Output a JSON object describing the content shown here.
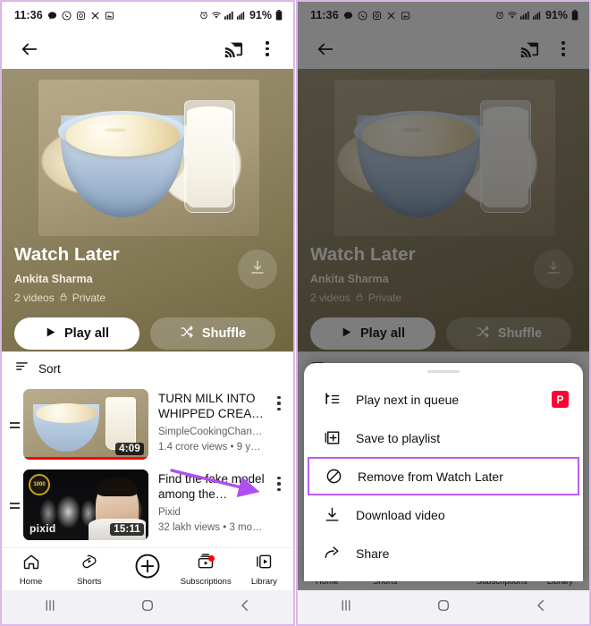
{
  "meta": {
    "accent_purple": "#bd5cf3",
    "frame_purple": "#d9b8e8",
    "youtube_red": "#ff0000"
  },
  "status_bar": {
    "clock": "11:36",
    "left_icons": [
      "message-icon",
      "whatsapp-icon",
      "instagram-icon",
      "snapchat-icon",
      "gallery-icon"
    ],
    "right_icons": [
      "alarm-icon",
      "wifi-icon",
      "signal-icon",
      "signal-icon-2"
    ],
    "battery_percent": "91%"
  },
  "app_bar": {
    "back_label": "back-arrow",
    "cast_label": "cast-icon",
    "overflow_label": "more-options"
  },
  "hero": {
    "title": "Watch Later",
    "owner": "Ankita Sharma",
    "video_count": "2 videos",
    "privacy": "Private",
    "privacy_icon": "lock-icon",
    "download_icon": "download-icon",
    "play_all_label": "Play all",
    "shuffle_label": "Shuffle"
  },
  "sort": {
    "label": "Sort",
    "icon": "sort-icon"
  },
  "videos": [
    {
      "title": "TURN MILK INTO WHIPPED CREA…",
      "channel": "SimpleCookingChan…",
      "stats": "1.4 crore views • 9 y…",
      "duration": "4:09",
      "progress_percent": 100,
      "thumb_class": "t1"
    },
    {
      "title": "Find the fake model among the…",
      "channel": "Pixid",
      "stats": "32 lakh views • 3 mo…",
      "duration": "15:11",
      "progress_percent": 0,
      "thumb_class": "t2",
      "thumb_badge": "1000",
      "thumb_logo": "pixid"
    }
  ],
  "bottom_nav": [
    {
      "label": "Home",
      "icon": "home-icon",
      "badge": false
    },
    {
      "label": "Shorts",
      "icon": "shorts-icon",
      "badge": false
    },
    {
      "label": "",
      "icon": "create-plus-icon",
      "badge": false
    },
    {
      "label": "Subscriptions",
      "icon": "subscriptions-icon",
      "badge": true
    },
    {
      "label": "Library",
      "icon": "library-icon",
      "badge": false
    }
  ],
  "system_nav": {
    "recents": "recents-icon",
    "home": "home-square-icon",
    "back": "back-chevron-icon"
  },
  "sheet": {
    "items": [
      {
        "label": "Play next in queue",
        "icon": "queue-next-icon",
        "badge": "P",
        "highlighted": false
      },
      {
        "label": "Save to playlist",
        "icon": "save-playlist-icon",
        "badge": "",
        "highlighted": false
      },
      {
        "label": "Remove from Watch Later",
        "icon": "remove-circle-icon",
        "badge": "",
        "highlighted": true
      },
      {
        "label": "Download video",
        "icon": "download-icon",
        "badge": "",
        "highlighted": false
      },
      {
        "label": "Share",
        "icon": "share-icon",
        "badge": "",
        "highlighted": false
      }
    ]
  }
}
